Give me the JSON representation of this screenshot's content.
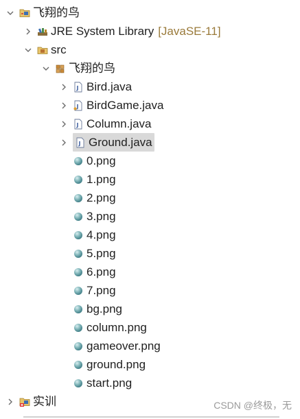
{
  "tree": {
    "project": {
      "label": "飞翔的鸟"
    },
    "jre": {
      "label": "JRE System Library",
      "decoration": "[JavaSE-11]"
    },
    "src": {
      "label": "src"
    },
    "package": {
      "label": "飞翔的鸟"
    },
    "java_files": [
      "Bird.java",
      "BirdGame.java",
      "Column.java",
      "Ground.java"
    ],
    "png_files": [
      "0.png",
      "1.png",
      "2.png",
      "3.png",
      "4.png",
      "5.png",
      "6.png",
      "7.png",
      "bg.png",
      "column.png",
      "gameover.png",
      "ground.png",
      "start.png"
    ],
    "other_project": {
      "label": "实训"
    },
    "selected": "Ground.java"
  },
  "watermark": "CSDN @终极，无",
  "colors": {
    "selection_bg": "#d9d9d9",
    "decoration": "#9a7a3a",
    "png_icon": "#4f8c94"
  }
}
